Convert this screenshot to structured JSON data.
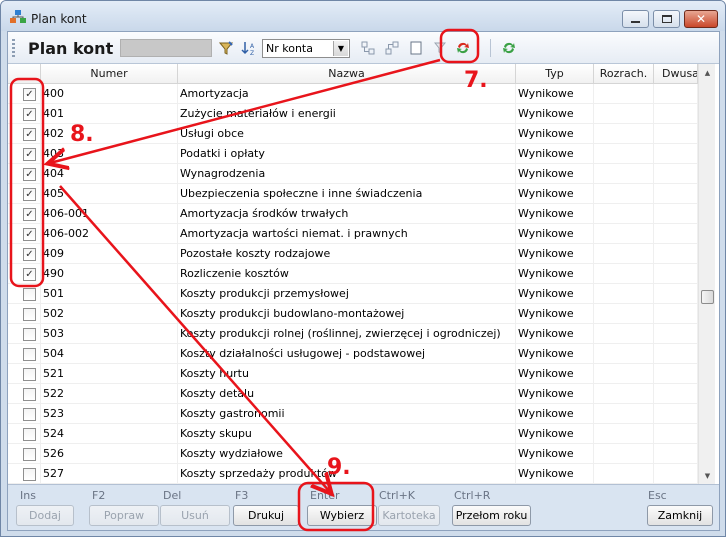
{
  "window": {
    "title": "Plan kont",
    "controls": [
      "minimize-icon",
      "maximize-icon",
      "close-icon"
    ]
  },
  "toolbar": {
    "title": "Plan kont",
    "search_value": "",
    "sort_select": "Nr konta",
    "icons": [
      "filter-icon",
      "sort-az-icon",
      "tree-expand-icon",
      "tree-collapse-icon",
      "blank-page-icon",
      "filter-clear-icon",
      "refresh-red-icon",
      "refresh-green-icon"
    ]
  },
  "grid": {
    "columns": [
      "",
      "Numer",
      "Nazwa",
      "Typ",
      "Rozrach.",
      "Dwusa"
    ],
    "rows": [
      {
        "checked": true,
        "numer": "400",
        "nazwa": "Amortyzacja",
        "typ": "Wynikowe"
      },
      {
        "checked": true,
        "numer": "401",
        "nazwa": "Zużycie materiałów i energii",
        "typ": "Wynikowe"
      },
      {
        "checked": true,
        "numer": "402",
        "nazwa": "Usługi obce",
        "typ": "Wynikowe"
      },
      {
        "checked": true,
        "numer": "403",
        "nazwa": "Podatki i opłaty",
        "typ": "Wynikowe"
      },
      {
        "checked": true,
        "numer": "404",
        "nazwa": "Wynagrodzenia",
        "typ": "Wynikowe"
      },
      {
        "checked": true,
        "numer": "405",
        "nazwa": "Ubezpieczenia społeczne i inne świadczenia",
        "typ": "Wynikowe"
      },
      {
        "checked": true,
        "numer": "406-001",
        "nazwa": "Amortyzacja środków trwałych",
        "typ": "Wynikowe"
      },
      {
        "checked": true,
        "numer": "406-002",
        "nazwa": "Amortyzacja wartości niemat. i prawnych",
        "typ": "Wynikowe"
      },
      {
        "checked": true,
        "numer": "409",
        "nazwa": "Pozostałe koszty rodzajowe",
        "typ": "Wynikowe"
      },
      {
        "checked": true,
        "numer": "490",
        "nazwa": "Rozliczenie kosztów",
        "typ": "Wynikowe"
      },
      {
        "checked": false,
        "numer": "501",
        "nazwa": "Koszty produkcji przemysłowej",
        "typ": "Wynikowe"
      },
      {
        "checked": false,
        "numer": "502",
        "nazwa": "Koszty produkcji budowlano-montażowej",
        "typ": "Wynikowe"
      },
      {
        "checked": false,
        "numer": "503",
        "nazwa": "Koszty produkcji rolnej (roślinnej, zwierzęcej i ogrodniczej)",
        "typ": "Wynikowe"
      },
      {
        "checked": false,
        "numer": "504",
        "nazwa": "Koszty działalności usługowej - podstawowej",
        "typ": "Wynikowe"
      },
      {
        "checked": false,
        "numer": "521",
        "nazwa": "Koszty hurtu",
        "typ": "Wynikowe"
      },
      {
        "checked": false,
        "numer": "522",
        "nazwa": "Koszty detalu",
        "typ": "Wynikowe"
      },
      {
        "checked": false,
        "numer": "523",
        "nazwa": "Koszty gastronomii",
        "typ": "Wynikowe"
      },
      {
        "checked": false,
        "numer": "524",
        "nazwa": "Koszty skupu",
        "typ": "Wynikowe"
      },
      {
        "checked": false,
        "numer": "526",
        "nazwa": "Koszty wydziałowe",
        "typ": "Wynikowe"
      },
      {
        "checked": false,
        "numer": "527",
        "nazwa": "Koszty sprzedaży produktów",
        "typ": "Wynikowe"
      }
    ]
  },
  "actions": [
    {
      "hint": "Ins",
      "label": "Dodaj",
      "enabled": false
    },
    {
      "hint": "F2",
      "label": "Popraw",
      "enabled": false
    },
    {
      "hint": "Del",
      "label": "Usuń",
      "enabled": false
    },
    {
      "hint": "F3",
      "label": "Drukuj",
      "enabled": true
    },
    {
      "hint": "Enter",
      "label": "Wybierz",
      "enabled": true
    },
    {
      "hint": "Ctrl+K",
      "label": "Kartoteka",
      "enabled": false
    },
    {
      "hint": "Ctrl+R",
      "label": "Przełom roku",
      "enabled": true
    },
    {
      "hint": "Esc",
      "label": "Zamknij",
      "enabled": true
    }
  ],
  "annotations": {
    "step7": "7.",
    "step8": "8.",
    "step9": "9.",
    "color": "#e8141b"
  },
  "colors": {
    "window_frame": "#cfdceb",
    "button_bar": "#d9e4f1",
    "highlight_red": "#e8141b"
  }
}
